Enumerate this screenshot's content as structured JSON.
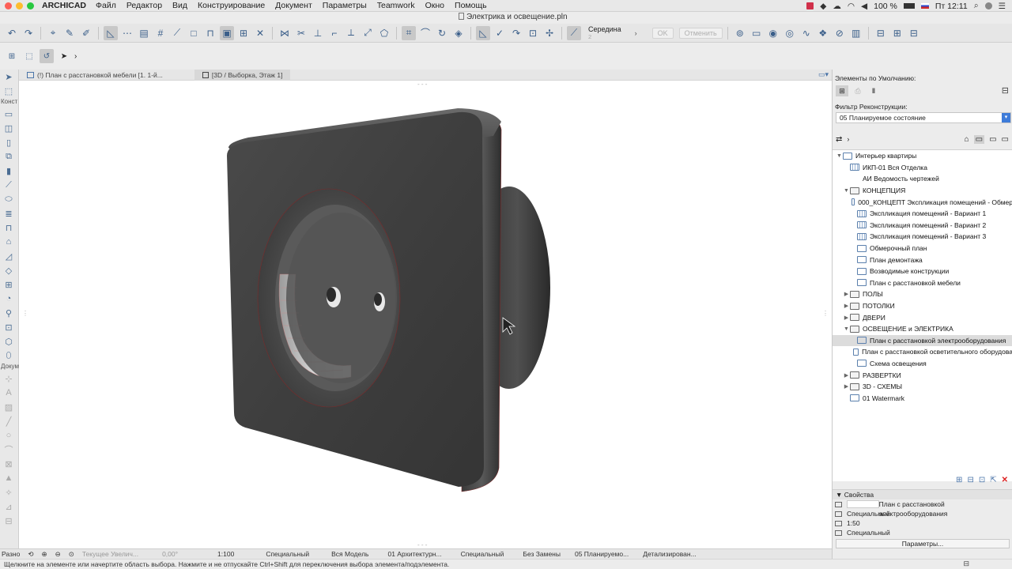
{
  "menubar": {
    "app": "ARCHICAD",
    "items": [
      "Файл",
      "Редактор",
      "Вид",
      "Конструирование",
      "Документ",
      "Параметры",
      "Teamwork",
      "Окно",
      "Помощь"
    ],
    "battery": "100 %",
    "clock": "Пт 12:11"
  },
  "window": {
    "title": "Электрика и освещение.pln"
  },
  "toolbar": {
    "middle_label": "Середина",
    "middle_sub": "2",
    "ok_label": "OK",
    "cancel_label": "Отменить"
  },
  "toolbox": {
    "section_construct": "Конст",
    "section_document": "Докум"
  },
  "tabs": [
    {
      "label": "(!) План с расстановкой мебели [1. 1-й..."
    },
    {
      "label": "[3D / Выборка, Этаж 1]"
    }
  ],
  "statusbar": {
    "diff": "Разно",
    "zoom_label": "Текущее Увелич...",
    "angle": "0,00°",
    "scale": "1:100",
    "layer_set": "Специальный",
    "model_view": "Вся Модель",
    "pen_set": "01 Архитектурн...",
    "mvo": "Специальный",
    "renovation": "Без Замены",
    "reno_filter": "05 Планируемо...",
    "detail": "Детализирован..."
  },
  "hint": "Щелкните на элементе или начертите область выбора. Нажмите и не отпускайте Ctrl+Shift для переключения выбора элемента/подэлемента.",
  "panel": {
    "defaults_label": "Элементы по Умолчанию:",
    "recon_label": "Фильтр Реконструкции:",
    "recon_value": "05 Планируемое состояние"
  },
  "tree": [
    {
      "label": "Интерьер квартиры",
      "indent": 0,
      "icon": "project",
      "toggle": "▼"
    },
    {
      "label": "ИКП-01 Вся Отделка",
      "indent": 1,
      "icon": "sheet",
      "toggle": ""
    },
    {
      "label": "АИ Ведомость чертежей",
      "indent": 1,
      "icon": "none",
      "toggle": ""
    },
    {
      "label": "КОНЦЕПЦИЯ",
      "indent": 1,
      "icon": "folder",
      "toggle": "▼"
    },
    {
      "label": "000_КОНЦЕПТ Экспликация помещений - Обмер",
      "indent": 2,
      "icon": "sheet",
      "toggle": ""
    },
    {
      "label": "Экспликация помещений - Вариант 1",
      "indent": 2,
      "icon": "sheet",
      "toggle": ""
    },
    {
      "label": "Экспликация помещений - Вариант 2",
      "indent": 2,
      "icon": "sheet",
      "toggle": ""
    },
    {
      "label": "Экспликация помещений - Вариант 3",
      "indent": 2,
      "icon": "sheet",
      "toggle": ""
    },
    {
      "label": "Обмерочный план",
      "indent": 2,
      "icon": "plan",
      "toggle": ""
    },
    {
      "label": "План демонтажа",
      "indent": 2,
      "icon": "plan",
      "toggle": ""
    },
    {
      "label": "Возводимые конструкции",
      "indent": 2,
      "icon": "plan",
      "toggle": ""
    },
    {
      "label": "План с расстановкой мебели",
      "indent": 2,
      "icon": "plan",
      "toggle": ""
    },
    {
      "label": "ПОЛЫ",
      "indent": 1,
      "icon": "folder",
      "toggle": "▶"
    },
    {
      "label": "ПОТОЛКИ",
      "indent": 1,
      "icon": "folder",
      "toggle": "▶"
    },
    {
      "label": "ДВЕРИ",
      "indent": 1,
      "icon": "folder",
      "toggle": "▶"
    },
    {
      "label": "ОСВЕЩЕНИЕ и ЭЛЕКТРИКА",
      "indent": 1,
      "icon": "folder",
      "toggle": "▼"
    },
    {
      "label": "План с расстановкой электрооборудования",
      "indent": 2,
      "icon": "plan",
      "toggle": "",
      "selected": true
    },
    {
      "label": "План с расстановкой осветительного оборудова",
      "indent": 2,
      "icon": "plan",
      "toggle": ""
    },
    {
      "label": "Схема освещения",
      "indent": 2,
      "icon": "plan",
      "toggle": ""
    },
    {
      "label": "РАЗВЕРТКИ",
      "indent": 1,
      "icon": "folder",
      "toggle": "▶"
    },
    {
      "label": "3D - СХЕМЫ",
      "indent": 1,
      "icon": "folder",
      "toggle": "▶"
    },
    {
      "label": "01 Watermark",
      "indent": 1,
      "icon": "plan",
      "toggle": ""
    }
  ],
  "properties": {
    "header": "Свойства",
    "view_name": "План с расстановкой электрооборудования",
    "layer_set": "Специальный",
    "scale": "1:50",
    "structure": "Специальный",
    "params_button": "Параметры..."
  }
}
